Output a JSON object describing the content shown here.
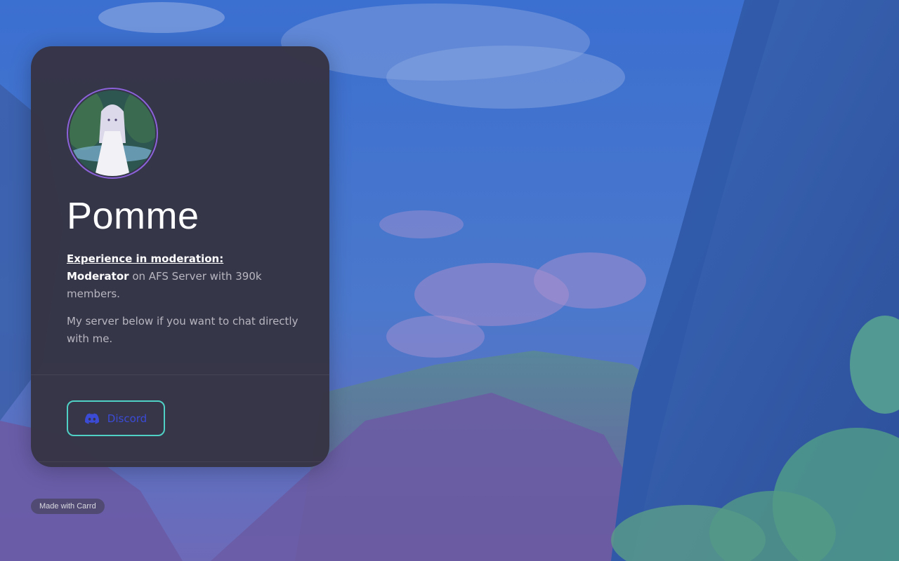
{
  "profile": {
    "name": "Pomme",
    "avatar_alt": "avatar"
  },
  "bio": {
    "heading": "Experience in moderation:",
    "role": "Moderator",
    "role_detail": " on AFS Server with 390k members.",
    "invite": "My server below if you want to chat directly with me."
  },
  "links": {
    "discord_label": "Discord",
    "discord_icon": "discord-icon"
  },
  "footer": {
    "badge": "Made with Carrd"
  },
  "colors": {
    "card_bg": "#363444",
    "avatar_ring": "#8b62d9",
    "button_border": "#4fd1c5",
    "button_text": "#3b4bd6"
  }
}
